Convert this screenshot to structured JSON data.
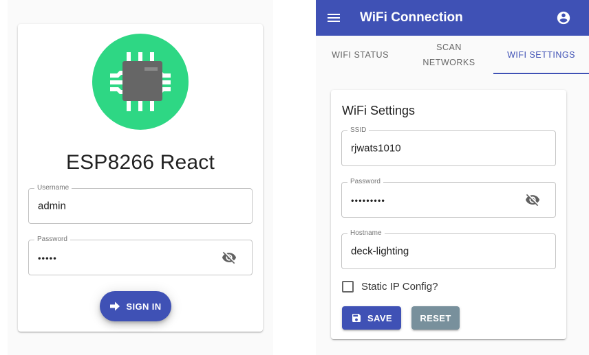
{
  "login": {
    "logo_icon": "chip-icon",
    "title": "ESP8266 React",
    "username": {
      "label": "Username",
      "value": "admin"
    },
    "password": {
      "label": "Password",
      "value": "•••••",
      "toggle_icon": "visibility-off-icon"
    },
    "signin_label": "SIGN IN",
    "signin_icon": "arrow-forward-icon"
  },
  "wifi": {
    "appbar": {
      "menu_icon": "menu-icon",
      "title": "WiFi Connection",
      "account_icon": "account-circle-icon"
    },
    "tabs": [
      {
        "label": "WIFI STATUS",
        "active": false
      },
      {
        "label": "SCAN NETWORKS",
        "active": false
      },
      {
        "label": "WIFI SETTINGS",
        "active": true
      }
    ],
    "card_title": "WiFi Settings",
    "ssid": {
      "label": "SSID",
      "value": "rjwats1010"
    },
    "password": {
      "label": "Password",
      "value": "•••••••••",
      "toggle_icon": "visibility-off-icon"
    },
    "hostname": {
      "label": "Hostname",
      "value": "deck-lighting"
    },
    "static_ip": {
      "label": "Static IP Config?",
      "checked": false
    },
    "save_label": "SAVE",
    "reset_label": "RESET",
    "colors": {
      "primary": "#3f51b5",
      "secondary": "#78909c",
      "logo_green": "#2ed784"
    }
  }
}
